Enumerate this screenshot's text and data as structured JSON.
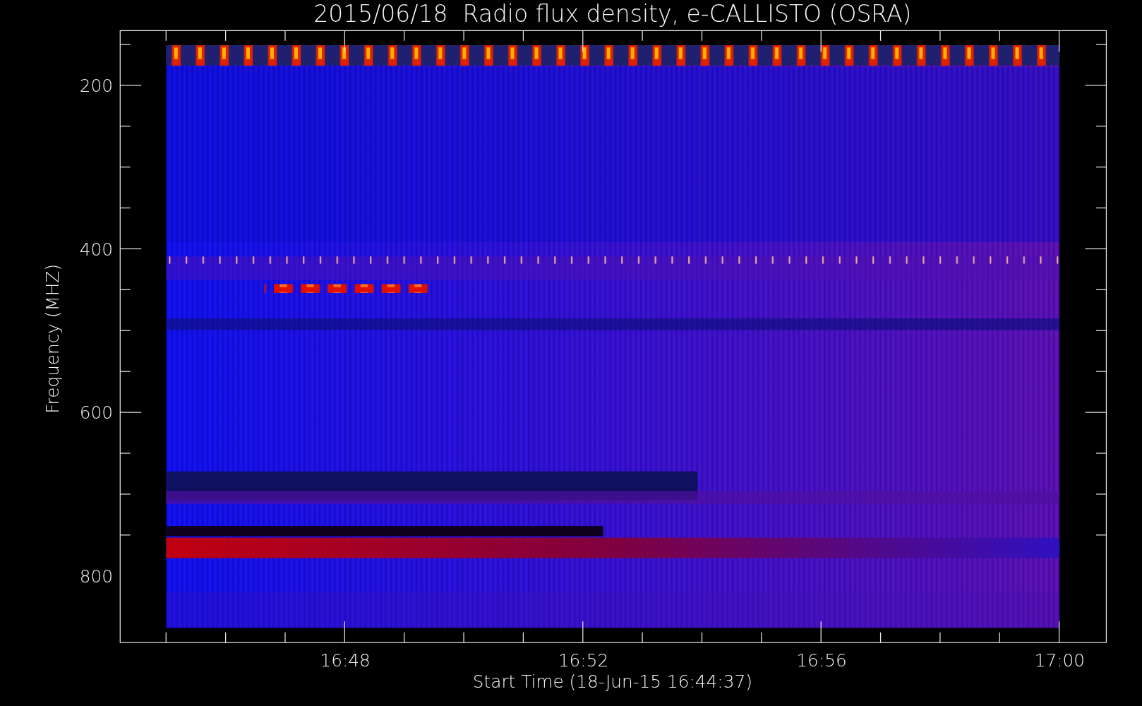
{
  "title": "2015/06/18  Radio flux density, e-CALLISTO (OSRA)",
  "y_axis": {
    "label": "Frequency (MHZ)",
    "ticks": [
      "200",
      "400",
      "600",
      "800"
    ]
  },
  "x_axis": {
    "label": "Start Time (18-Jun-15 16:44:37)",
    "ticks": [
      "16:48",
      "16:52",
      "16:56",
      "17:00"
    ]
  }
}
